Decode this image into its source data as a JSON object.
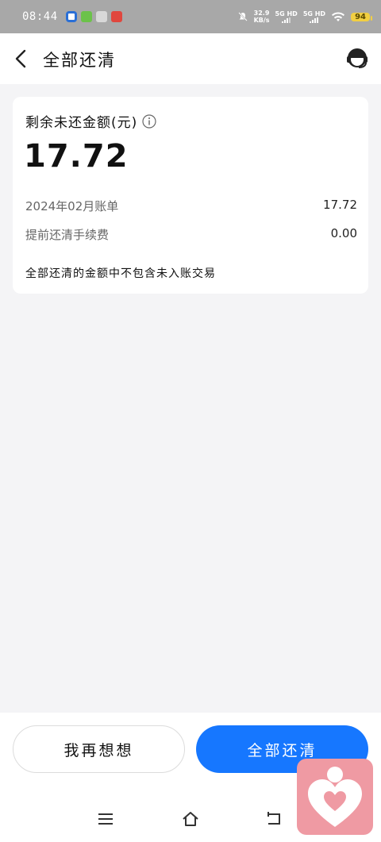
{
  "status_bar": {
    "time": "08:44",
    "net_speed_value": "32.9",
    "net_speed_unit": "KB/s",
    "sim1": "5G HD",
    "sim2": "5G HD",
    "battery": "94"
  },
  "header": {
    "title": "全部还清"
  },
  "card": {
    "label": "剩余未还金额(元)",
    "amount": "17.72",
    "rows": [
      {
        "label": "2024年02月账单",
        "value": "17.72"
      },
      {
        "label": "提前还清手续费",
        "value": "0.00"
      }
    ],
    "note": "全部还清的金额中不包含未入账交易"
  },
  "actions": {
    "secondary": "我再想想",
    "primary": "全部还清"
  },
  "colors": {
    "primary": "#1677ff",
    "background": "#f4f4f6",
    "status_bar": "#a8a8a8",
    "widget": "#ef9aa3"
  },
  "icons": [
    "back-icon",
    "customer-service-icon",
    "info-icon",
    "menu-icon",
    "home-icon",
    "back-nav-icon",
    "heart-icon"
  ]
}
